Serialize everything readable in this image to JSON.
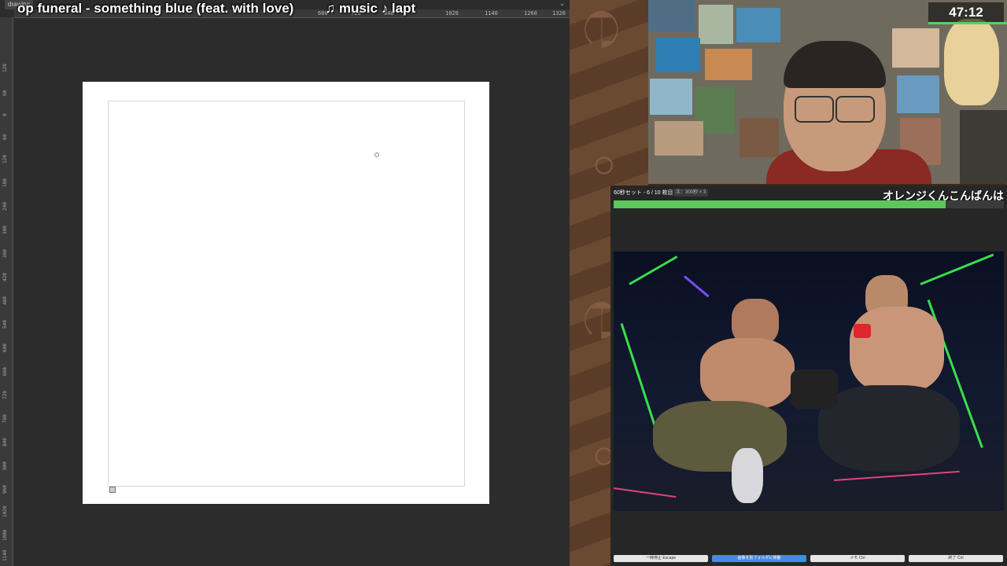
{
  "drawing_app": {
    "tab_title": "drawing",
    "music_ticker": {
      "track": "op funeral - something blue (feat. with love)",
      "tag": "♫ music ♪ lapt"
    },
    "top_ruler_ticks": [
      "660",
      "720",
      "840",
      "1020",
      "1140",
      "1260",
      "1320"
    ],
    "left_ruler_ticks": [
      "120",
      "60",
      "0",
      "60",
      "120",
      "180",
      "240",
      "300",
      "360",
      "420",
      "480",
      "540",
      "600",
      "660",
      "720",
      "780",
      "840",
      "900",
      "960",
      "1020",
      "1080",
      "1140"
    ]
  },
  "stream": {
    "timer": "47:12",
    "set_label": "60秒セット - 6 / 10 枚目",
    "next_label": "次：300秒 × 3",
    "greeting": "オレンジくんこんばんは",
    "progress_fraction": 0.85,
    "controls": [
      "一時停止 Escape",
      "画像を別フォルダに移動",
      "メモ Ctrl",
      "終了 Ctrl"
    ],
    "colors": {
      "progress": "#5cc85c",
      "primary_button": "#3d8ee6",
      "neon": "#37e04a"
    }
  }
}
